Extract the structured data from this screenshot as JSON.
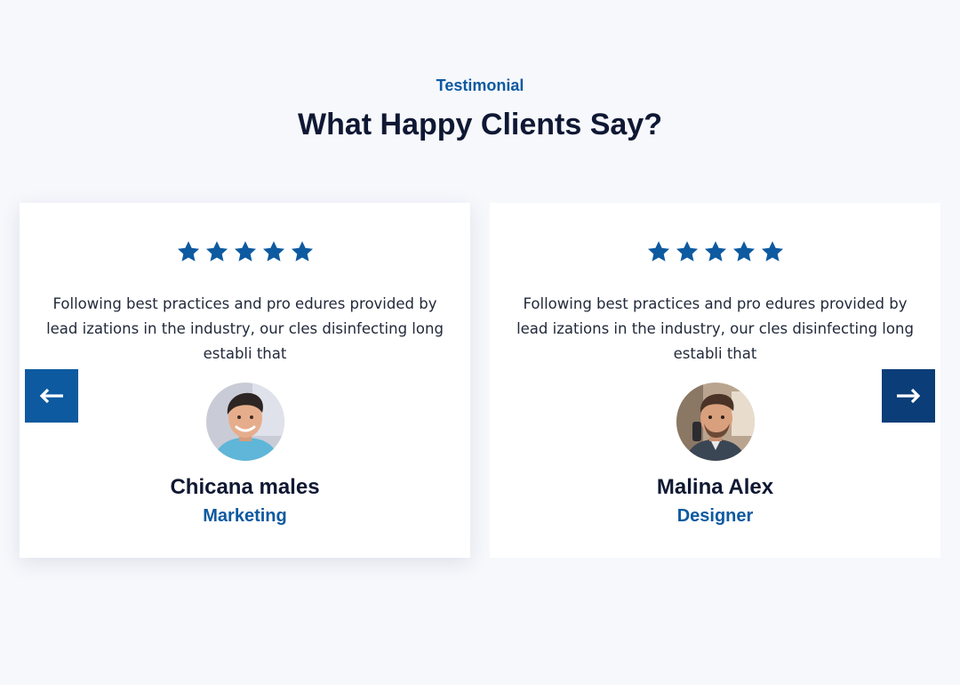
{
  "section": {
    "eyebrow": "Testimonial",
    "heading": "What Happy Clients Say?"
  },
  "colors": {
    "accent": "#0d5aa0",
    "heading": "#0f1833",
    "star": "#0d5aa0",
    "background": "#f7f8fc",
    "card": "#ffffff"
  },
  "testimonials": [
    {
      "rating": 5,
      "quote": "Following best practices and pro edures provided by lead izations in the industry, our cles disinfecting long establi that",
      "name": "Chicana males",
      "role": "Marketing",
      "avatar_icon": "avatar-photo"
    },
    {
      "rating": 5,
      "quote": "Following best practices and pro edures provided by lead izations in the industry, our cles disinfecting long establi that",
      "name": "Malina Alex",
      "role": "Designer",
      "avatar_icon": "avatar-photo"
    }
  ],
  "navigation": {
    "prev_icon": "arrow-left-icon",
    "next_icon": "arrow-right-icon"
  }
}
